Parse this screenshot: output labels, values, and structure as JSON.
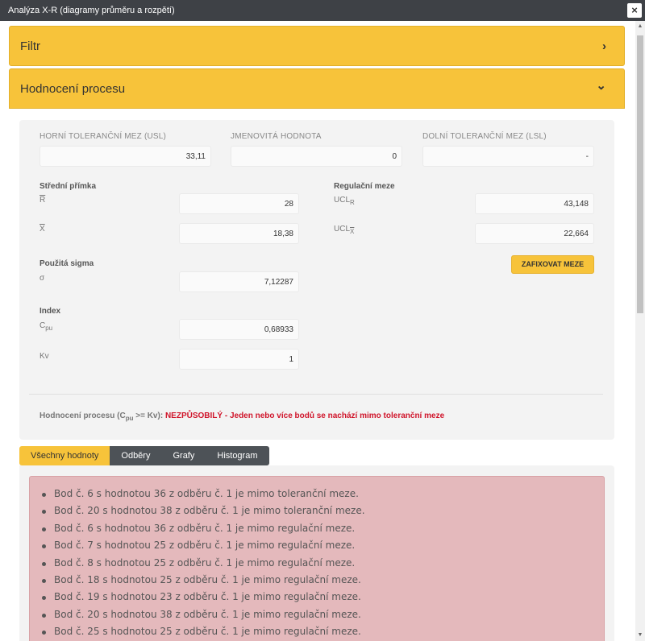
{
  "window": {
    "title": "Analýza X-R (diagramy průměru a rozpětí)",
    "close_symbol": "×"
  },
  "accordion": {
    "filtr": {
      "label": "Filtr",
      "chevron": "›"
    },
    "hodnoceni": {
      "label": "Hodnocení procesu",
      "chevron": "⌄"
    }
  },
  "tolerances": {
    "usl": {
      "label": "HORNÍ TOLERANČNÍ MEZ (USL)",
      "value": "33,11"
    },
    "nominal": {
      "label": "JMENOVITÁ HODNOTA",
      "value": "0"
    },
    "lsl": {
      "label": "DOLNÍ TOLERANČNÍ MEZ (LSL)",
      "value": "-"
    }
  },
  "center_line": {
    "heading": "Střední přímka",
    "r_label": "R",
    "r_value": "28",
    "x_label": "X",
    "x_value": "18,38"
  },
  "control_limits": {
    "heading": "Regulační meze",
    "ucl_r_label": "UCL",
    "ucl_r_sub": "R",
    "ucl_r_value": "43,148",
    "ucl_x_label": "UCL",
    "ucl_x_sub": "X",
    "ucl_x_value": "22,664",
    "fix_button": "ZAFIXOVAT MEZE"
  },
  "sigma": {
    "heading": "Použitá sigma",
    "label": "σ",
    "value": "7,12287"
  },
  "index": {
    "heading": "Index",
    "cpu_label": "C",
    "cpu_sub": "pu",
    "cpu_value": "0,68933",
    "kv_label": "Kv",
    "kv_value": "1"
  },
  "evaluation": {
    "prefix": "Hodnocení procesu (C",
    "prefix_sub": "pu",
    "prefix_end": " >= Kv):",
    "result": "NEZPŮSOBILÝ - Jeden nebo více bodů se nachází mimo toleranční meze"
  },
  "tabs": [
    "Všechny hodnoty",
    "Odběry",
    "Grafy",
    "Histogram"
  ],
  "messages": [
    "Bod č. 6 s hodnotou 36 z odběru č. 1 je mimo toleranční meze.",
    "Bod č. 20 s hodnotou 38 z odběru č. 1 je mimo toleranční meze.",
    "Bod č. 6 s hodnotou 36 z odběru č. 1 je mimo regulační meze.",
    "Bod č. 7 s hodnotou 25 z odběru č. 1 je mimo regulační meze.",
    "Bod č. 8 s hodnotou 25 z odběru č. 1 je mimo regulační meze.",
    "Bod č. 18 s hodnotou 25 z odběru č. 1 je mimo regulační meze.",
    "Bod č. 19 s hodnotou 23 z odběru č. 1 je mimo regulační meze.",
    "Bod č. 20 s hodnotou 38 z odběru č. 1 je mimo regulační meze.",
    "Bod č. 25 s hodnotou 25 z odběru č. 1 je mimo regulační meze."
  ],
  "colors": {
    "accent": "#f7c33a",
    "danger": "#d0142a",
    "titlebar": "#3e4146",
    "alert_bg": "#e4b9bc"
  }
}
